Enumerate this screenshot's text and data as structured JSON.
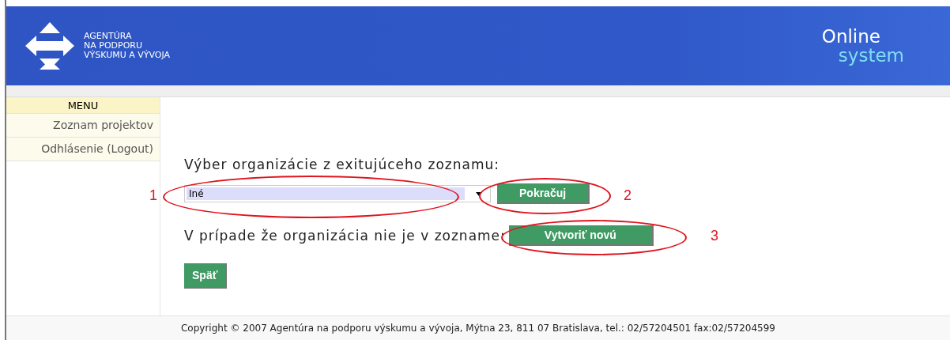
{
  "header": {
    "logo_lines": [
      "AGENTÚRA",
      "NA PODPORU",
      "VÝSKUMU A VÝVOJA"
    ],
    "product": [
      "Online",
      "system"
    ]
  },
  "sidebar": {
    "title": "MENU",
    "items": [
      {
        "label": "Zoznam projektov"
      },
      {
        "label": "Odhlásenie (Logout)"
      }
    ]
  },
  "form": {
    "heading": "Výber organizácie z exitujúceho zoznamu:",
    "select_value": "Iné",
    "continue_button": "Pokračuj",
    "missing_text": "V prípade že organizácia nie je v zozname:",
    "create_button": "Vytvoriť novú",
    "back_button": "Späť"
  },
  "annotations": [
    {
      "number": "1"
    },
    {
      "number": "2"
    },
    {
      "number": "3"
    }
  ],
  "footer": "Copyright © 2007 Agentúra na podporu výskumu a vývoja, Mýtna 23, 811 07 Bratislava, tel.: 02/57204501 fax:02/57204599"
}
